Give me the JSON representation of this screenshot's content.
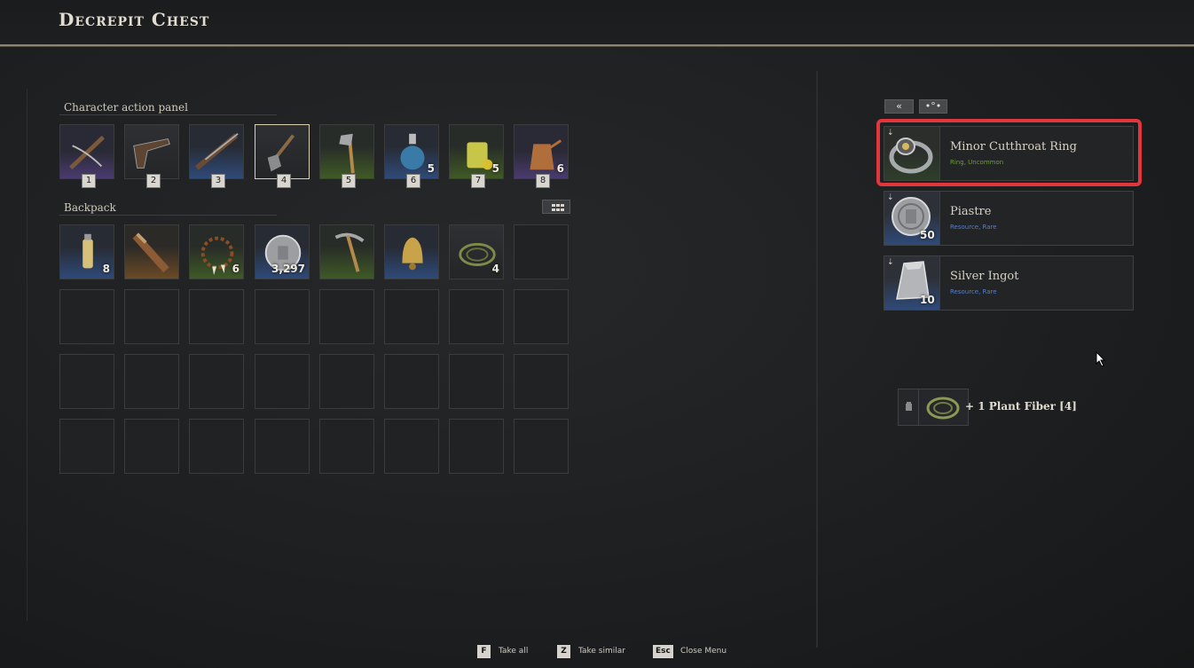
{
  "header": {
    "title": "Decrepit Chest"
  },
  "action_panel": {
    "label": "Character action panel",
    "slots": [
      {
        "hotkey": "1",
        "count": "",
        "icon": "crossbow-icon",
        "rarity": "purple"
      },
      {
        "hotkey": "2",
        "count": "",
        "icon": "flintlock-pistol-icon",
        "rarity": "none"
      },
      {
        "hotkey": "3",
        "count": "",
        "icon": "musket-icon",
        "rarity": "blue"
      },
      {
        "hotkey": "4",
        "count": "",
        "icon": "shovel-icon",
        "rarity": "none"
      },
      {
        "hotkey": "5",
        "count": "",
        "icon": "hatchet-icon",
        "rarity": "green"
      },
      {
        "hotkey": "6",
        "count": "5",
        "icon": "potion-flask-icon",
        "rarity": "blue"
      },
      {
        "hotkey": "7",
        "count": "5",
        "icon": "lemon-drink-icon",
        "rarity": "green"
      },
      {
        "hotkey": "8",
        "count": "6",
        "icon": "coffee-pot-icon",
        "rarity": "purple"
      }
    ]
  },
  "backpack": {
    "label": "Backpack",
    "items": [
      {
        "count": "8",
        "icon": "vial-bottle-icon",
        "rarity": "blue"
      },
      {
        "count": "",
        "icon": "blunderbuss-icon",
        "rarity": "orange"
      },
      {
        "count": "6",
        "icon": "tooth-necklace-icon",
        "rarity": "green"
      },
      {
        "count": "3,297",
        "icon": "silver-coin-icon",
        "rarity": "blue"
      },
      {
        "count": "",
        "icon": "pickaxe-icon",
        "rarity": "green"
      },
      {
        "count": "",
        "icon": "bell-icon",
        "rarity": "blue"
      },
      {
        "count": "4",
        "icon": "plant-fiber-icon",
        "rarity": "none"
      }
    ]
  },
  "chest_controls": {
    "take_all_glyph": "«",
    "sort_glyph": "•°•"
  },
  "loot": [
    {
      "name": "Minor Cutthroat Ring",
      "subtitle": "Ring, Uncommon",
      "count": "",
      "icon": "ring-icon",
      "rarity": "green"
    },
    {
      "name": "Piastre",
      "subtitle": "Resource, Rare",
      "count": "50",
      "icon": "silver-coin-icon",
      "rarity": "blue"
    },
    {
      "name": "Silver Ingot",
      "subtitle": "Resource, Rare",
      "count": "10",
      "icon": "silver-ingot-icon",
      "rarity": "blue"
    }
  ],
  "notification": {
    "text": "+ 1 Plant Fiber [4]",
    "icon": "plant-fiber-icon"
  },
  "footer": [
    {
      "key": "F",
      "label": "Take all"
    },
    {
      "key": "Z",
      "label": "Take similar"
    },
    {
      "key": "Esc",
      "label": "Close Menu"
    }
  ],
  "colors": {
    "highlight": "#e2353c",
    "rarity_blue": "#2f4a79",
    "rarity_green": "#3f5a25",
    "rarity_purple": "#4a3b70"
  }
}
